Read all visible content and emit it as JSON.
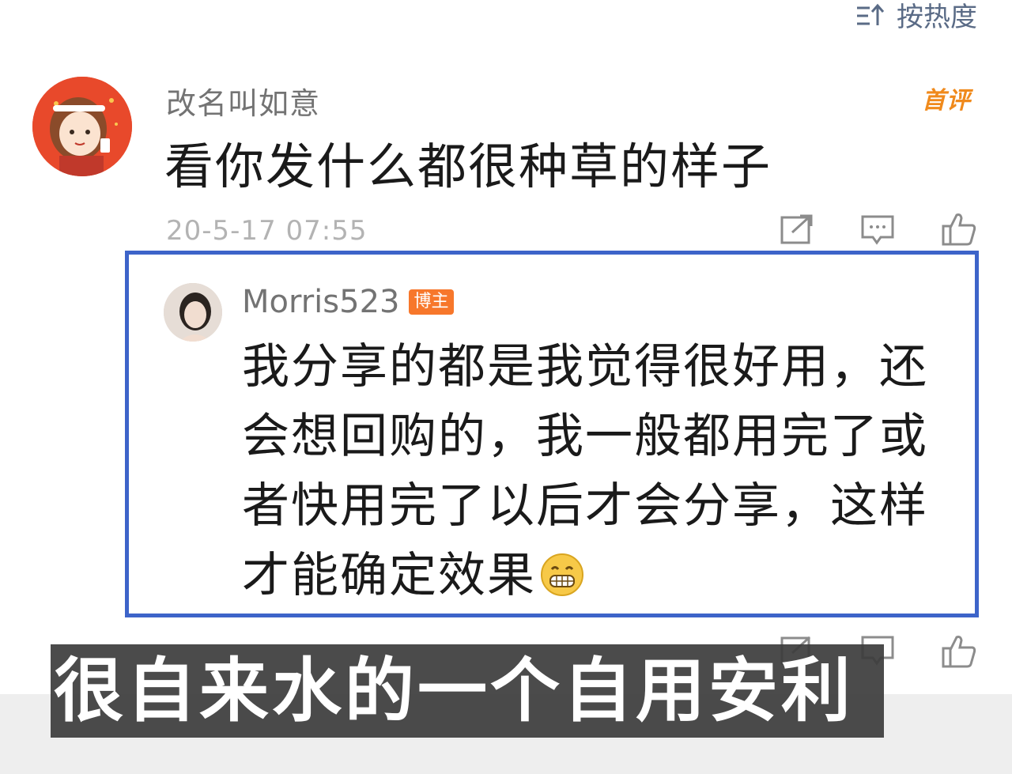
{
  "sort": {
    "label": "按热度"
  },
  "main_comment": {
    "username": "改名叫如意",
    "badge": "首评",
    "text": "看你发什么都很种草的样子",
    "timestamp": "20-5-17 07:55"
  },
  "reply": {
    "username": "Morris523",
    "badge": "博主",
    "text": "我分享的都是我觉得很好用，还会想回购的，我一般都用完了或者快用完了以后才会分享，这样才能确定效果"
  },
  "subtitle": "很自来水的一个自用安利",
  "colors": {
    "highlight_border": "#3d64c9",
    "badge_orange": "#f7772b",
    "first_badge": "#f08a1c",
    "avatar_red": "#e8492b"
  },
  "icons": {
    "sort": "sort-icon",
    "share": "share-icon",
    "comment": "comment-icon",
    "like": "like-icon",
    "emoji": "grin-emoji-icon"
  }
}
